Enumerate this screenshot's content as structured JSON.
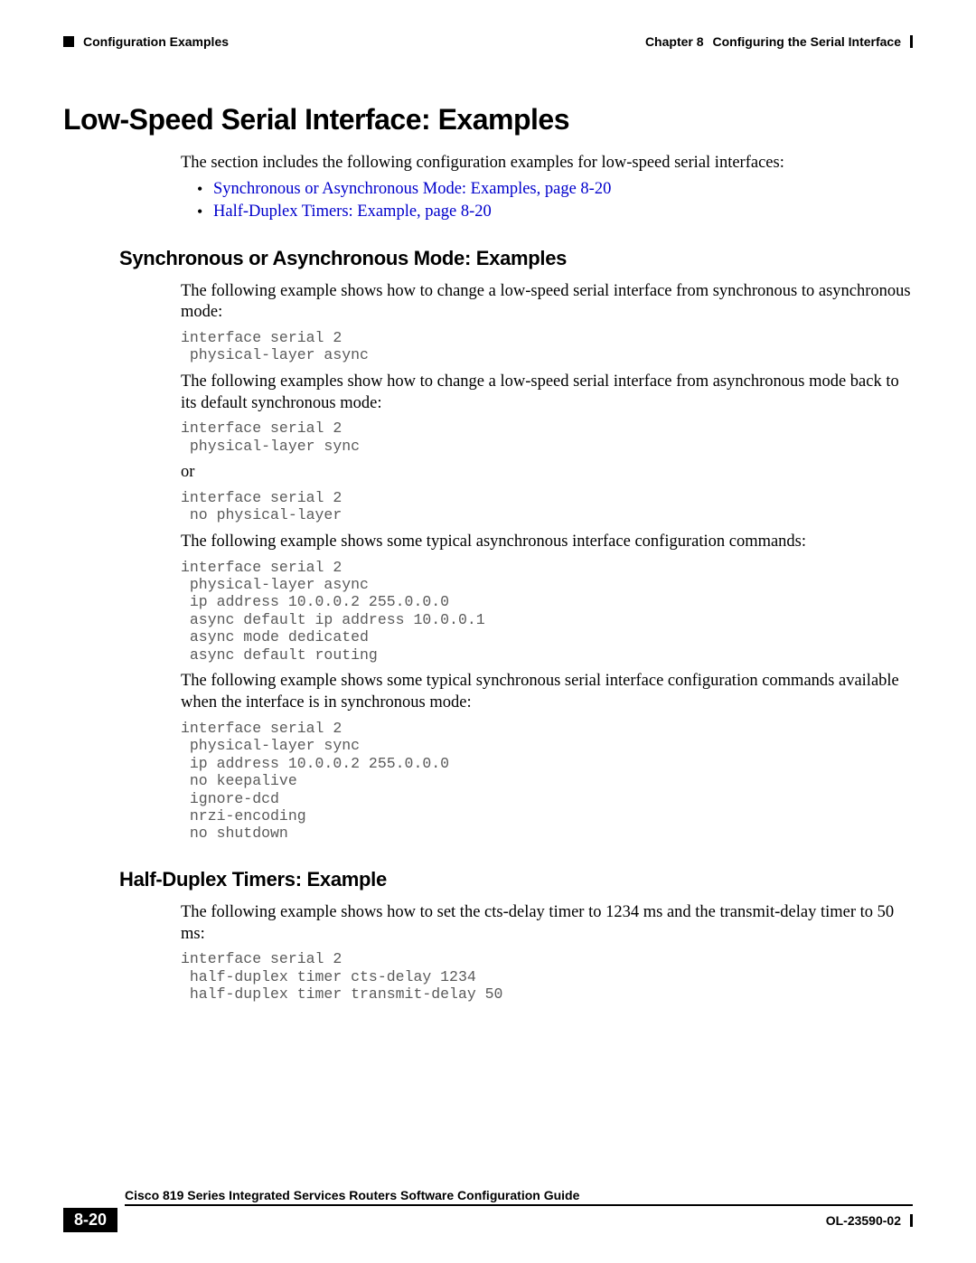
{
  "header": {
    "section_left": "Configuration Examples",
    "chapter_label": "Chapter 8",
    "chapter_title": "Configuring the Serial Interface"
  },
  "h1": "Low-Speed Serial Interface: Examples",
  "intro": "The section includes the following configuration examples for low-speed serial interfaces:",
  "links": [
    "Synchronous or Asynchronous Mode: Examples, page 8-20",
    "Half-Duplex Timers: Example, page 8-20"
  ],
  "sec1": {
    "title": "Synchronous or Asynchronous Mode: Examples",
    "p1": "The following example shows how to change a low-speed serial interface from synchronous to asynchronous mode:",
    "code1": "interface serial 2\n physical-layer async",
    "p2": "The following examples show how to change a low-speed serial interface from asynchronous mode back to its default synchronous mode:",
    "code2": "interface serial 2\n physical-layer sync",
    "or": "or",
    "code3": "interface serial 2\n no physical-layer",
    "p3": "The following example shows some typical asynchronous interface configuration commands:",
    "code4": "interface serial 2\n physical-layer async\n ip address 10.0.0.2 255.0.0.0\n async default ip address 10.0.0.1\n async mode dedicated\n async default routing",
    "p4": "The following example shows some typical synchronous serial interface configuration commands available when the interface is in synchronous mode:",
    "code5": "interface serial 2\n physical-layer sync\n ip address 10.0.0.2 255.0.0.0\n no keepalive\n ignore-dcd\n nrzi-encoding\n no shutdown"
  },
  "sec2": {
    "title": "Half-Duplex Timers: Example",
    "p1": "The following example shows how to set the cts-delay timer to 1234 ms and the transmit-delay timer to 50 ms:",
    "code1": "interface serial 2\n half-duplex timer cts-delay 1234\n half-duplex timer transmit-delay 50"
  },
  "footer": {
    "guide": "Cisco 819 Series Integrated Services Routers Software Configuration Guide",
    "page": "8-20",
    "doc_id": "OL-23590-02"
  }
}
